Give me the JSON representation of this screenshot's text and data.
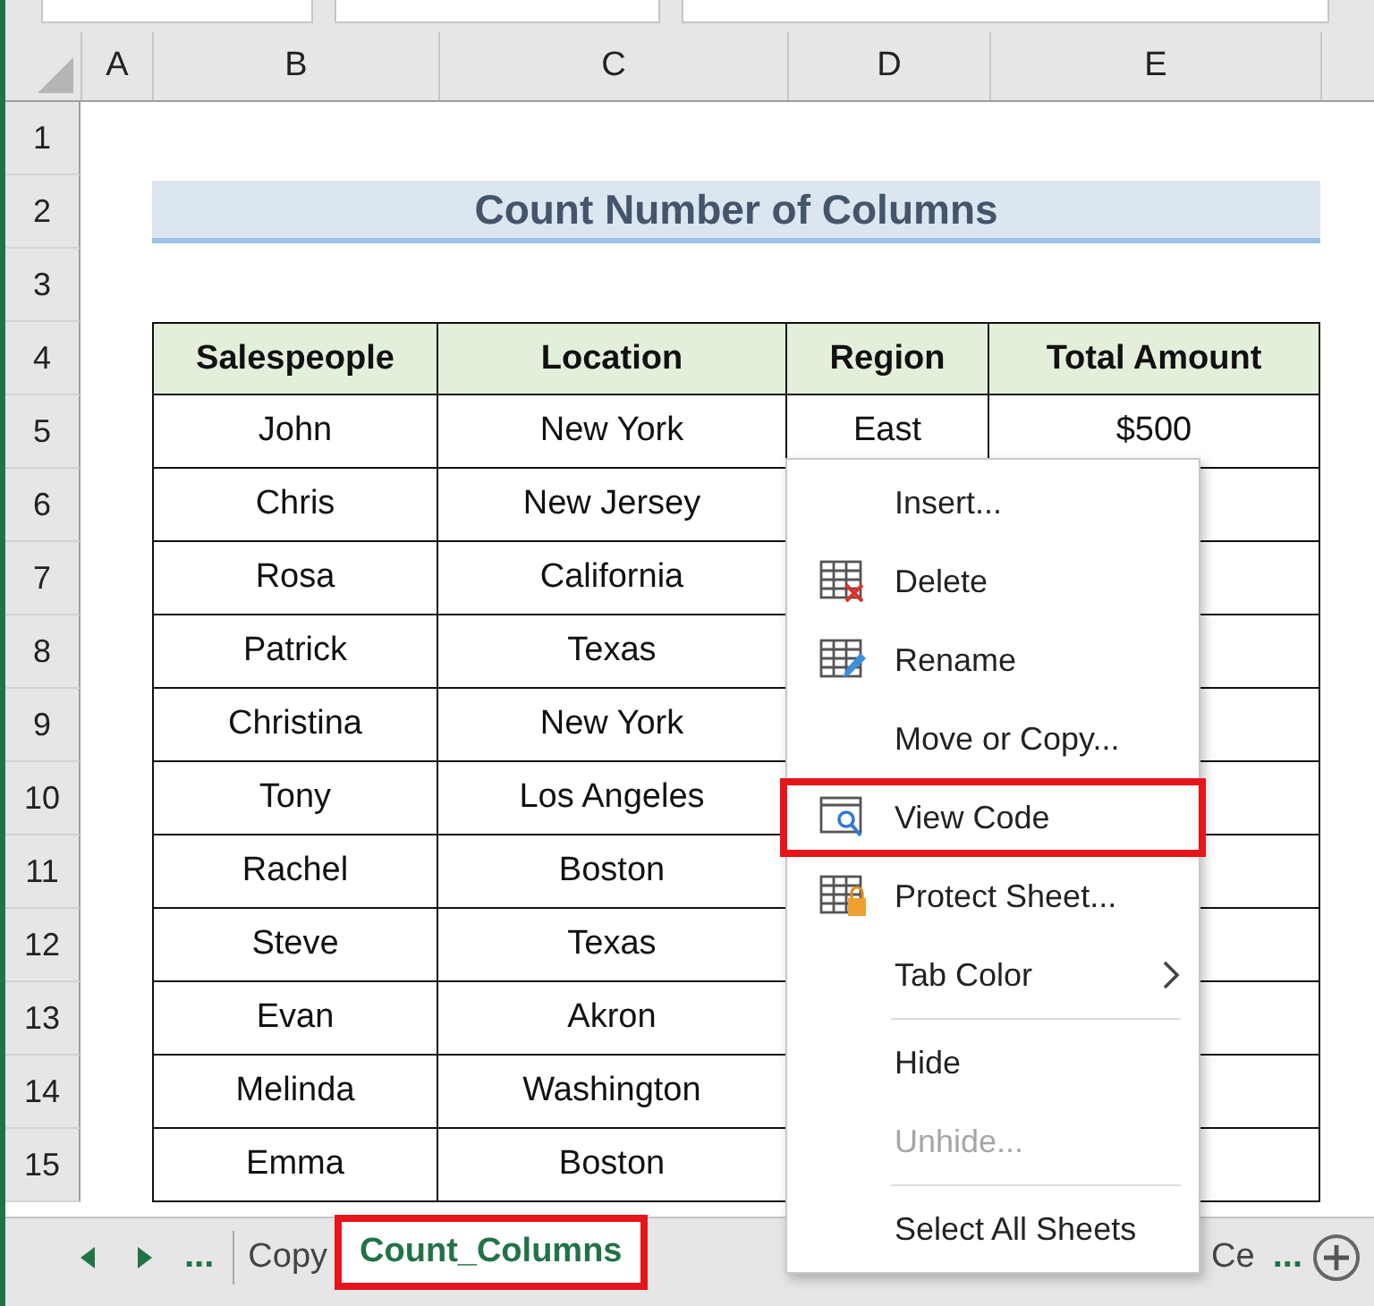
{
  "column_headers": [
    "A",
    "B",
    "C",
    "D",
    "E"
  ],
  "row_numbers": [
    "1",
    "2",
    "3",
    "4",
    "5",
    "6",
    "7",
    "8",
    "9",
    "10",
    "11",
    "12",
    "13",
    "14",
    "15"
  ],
  "title": "Count Number of Columns",
  "table": {
    "columns": [
      "Salespeople",
      "Location",
      "Region",
      "Total Amount"
    ],
    "rows": [
      [
        "John",
        "New York",
        "East",
        "$500"
      ],
      [
        "Chris",
        "New Jersey"
      ],
      [
        "Rosa",
        "California"
      ],
      [
        "Patrick",
        "Texas"
      ],
      [
        "Christina",
        "New York"
      ],
      [
        "Tony",
        "Los Angeles"
      ],
      [
        "Rachel",
        "Boston"
      ],
      [
        "Steve",
        "Texas"
      ],
      [
        "Evan",
        "Akron"
      ],
      [
        "Melinda",
        "Washington"
      ],
      [
        "Emma",
        "Boston"
      ]
    ]
  },
  "context_menu": {
    "items": [
      {
        "kind": "item",
        "label": "Insert...",
        "disabled": false,
        "highlighted": false
      },
      {
        "kind": "item",
        "label": "Delete",
        "disabled": false,
        "highlighted": false
      },
      {
        "kind": "item",
        "label": "Rename",
        "disabled": false,
        "highlighted": false
      },
      {
        "kind": "item",
        "label": "Move or Copy...",
        "disabled": false,
        "highlighted": false
      },
      {
        "kind": "item",
        "label": "View Code",
        "disabled": false,
        "highlighted": true
      },
      {
        "kind": "item",
        "label": "Protect Sheet...",
        "disabled": false,
        "highlighted": false
      },
      {
        "kind": "item",
        "label": "Tab Color",
        "submenu": true,
        "disabled": false,
        "highlighted": false
      },
      {
        "kind": "separator"
      },
      {
        "kind": "item",
        "label": "Hide",
        "disabled": false,
        "highlighted": false
      },
      {
        "kind": "item",
        "label": "Unhide...",
        "disabled": true,
        "highlighted": false
      },
      {
        "kind": "separator"
      },
      {
        "kind": "item",
        "label": "Select All Sheets",
        "disabled": false,
        "highlighted": false
      }
    ]
  },
  "sheet_tabs": {
    "more_left": "...",
    "tabs": [
      {
        "label": "Copy",
        "selected": false,
        "highlighted": false
      },
      {
        "label": "Count_Columns",
        "selected": true,
        "highlighted": true
      }
    ],
    "right_tab": {
      "label": "Ce",
      "selected": false
    },
    "more_right": "..."
  }
}
